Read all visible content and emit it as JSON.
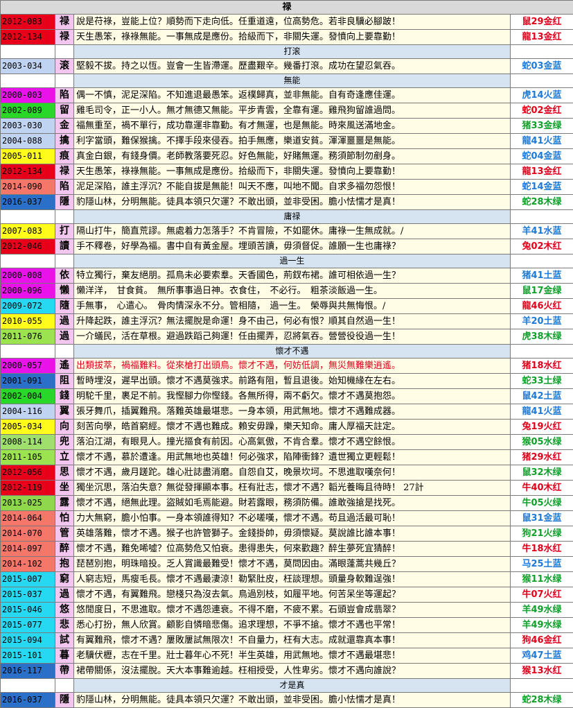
{
  "title": "禄",
  "groups": [
    {
      "name": "",
      "rows": [
        {
          "year": "2012-083",
          "yc": "y-red",
          "ch": "禄",
          "text": "說是苻祿，豈能上位？順勢而下走向低。任重道遠，位高勢危。若非良驥必腳跛！",
          "lot": "鼠29金红",
          "lc": "rd"
        },
        {
          "year": "2012-134",
          "yc": "y-red",
          "ch": "禄",
          "text": "天生愚笨，祿祿無能。一事無成是應份。拾級而下，非關失運。發憤向上要靠勤！",
          "lot": "龍13金红",
          "lc": "rd"
        }
      ]
    },
    {
      "name": "打滚",
      "rows": [
        {
          "year": "2003-034",
          "yc": "y-lightblue",
          "ch": "滚",
          "text": "堅毅不拔。持之以恆。豈會一生皆滯運。歷盡艱辛。幾番打滾。成功在望忍氣吞。",
          "lot": "蛇03金蓝",
          "lc": "bl"
        }
      ]
    },
    {
      "name": "無能",
      "rows": [
        {
          "year": "2000-003",
          "yc": "y-magenta",
          "ch": "陷",
          "text": "偶一不慎，泥足深陷。不知進退最愚笨。返樸歸真，並非無能。自有奇逢應佳運。",
          "lot": "虎14火蓝",
          "lc": "bl"
        },
        {
          "year": "2002-089",
          "yc": "y-green",
          "ch": "留",
          "text": "雞毛司令，正一小人。無才無德又無能。平步青雲，全靠有運。雞飛狗留誰過問。",
          "lot": "蛇02金红",
          "lc": "rd"
        },
        {
          "year": "2003-030",
          "yc": "y-lightblue",
          "ch": "金",
          "text": "福無重至，禍不單行，成功靠運非靠勤。有才無運，也是無能。時來風送滿地金。",
          "lot": "猪33金绿",
          "lc": "gr"
        },
        {
          "year": "2004-088",
          "yc": "y-lightblue",
          "ch": "擒",
          "text": "利字當頭，難保猴擒。不擇手段來侵吞。拍手無應，樂道安貧。渾渾噩噩是無能。",
          "lot": "龍41火蓝",
          "lc": "bl"
        },
        {
          "year": "2005-011",
          "yc": "y-yellow",
          "ch": "痕",
          "text": "真金白銀，有錢身價。老師教落要死忍。好色無能，好賭無運。務須節制勿剷身。",
          "lot": "蛇04金蓝",
          "lc": "bl"
        },
        {
          "year": "2012-134",
          "yc": "y-red",
          "ch": "禄",
          "text": "天生愚笨，祿祿無能。一事無成是應份。拾級而下，非關失運。發憤向上要靠勤！",
          "lot": "龍13金红",
          "lc": "rd"
        },
        {
          "year": "2014-090",
          "yc": "y-salmon",
          "ch": "陷",
          "text": "泥足深陷，誰主浮沉？不能自拔是無能！叫天不應，叫地不聞。自求多福勿怨恨！",
          "lot": "蛇14金蓝",
          "lc": "bl"
        },
        {
          "year": "2016-037",
          "yc": "y-blue",
          "ch": "隱",
          "text": "豹隱山林，分明無能。徒具本領只欠運？不敢出頭，並非受困。膽小怯懦才是真！",
          "lot": "蛇28木绿",
          "lc": "gr"
        }
      ]
    },
    {
      "name": "庸禄",
      "rows": [
        {
          "year": "2007-083",
          "yc": "y-yellow",
          "ch": "打",
          "text": "隔山打牛，簡直荒謬。無處着力怎落手？不肯冒險，不如罷休。庸祿一生無成就。/",
          "lot": "羊41水蓝",
          "lc": "bl"
        },
        {
          "year": "2012-046",
          "yc": "y-red",
          "ch": "讀",
          "text": "手不釋卷，好學為福。書中自有黃金屋。埋頭苦讀，毋須督促。誰願一生也庸祿？",
          "lot": "兔02木红",
          "lc": "rd"
        }
      ]
    },
    {
      "name": "過一生",
      "rows": [
        {
          "year": "2000-008",
          "yc": "y-magenta",
          "ch": "依",
          "text": "特立獨行，棄友絕朋。孤鳥未必要索羣。天香國色，荊釵布裙。誰可相依過一生？",
          "lot": "猪41土蓝",
          "lc": "bl"
        },
        {
          "year": "2000-096",
          "yc": "y-magenta",
          "ch": "懶",
          "text": "懶洋洋，　甘食貧。　無所事事過日神。衣食住，　不必行。　粗茶淡飯過一生。",
          "lot": "鼠17金绿",
          "lc": "gr"
        },
        {
          "year": "2009-072",
          "yc": "y-cyan",
          "ch": "隨",
          "text": "手無事，　心遣心。　骨肉情深永不分。管相隨，　過一生。　榮辱與共無悔恨。/",
          "lot": "龍46火红",
          "lc": "rd"
        },
        {
          "year": "2010-055",
          "yc": "y-yellow",
          "ch": "過",
          "text": "升降起跌，誰主浮沉？無法擺脫是命運！身不由己，何必有恨？順其自然過一生！",
          "lot": "羊20土蓝",
          "lc": "bl"
        },
        {
          "year": "2011-076",
          "yc": "y-lime",
          "ch": "過",
          "text": "一介蟻民，活在草根。避過跌蹈己夠運！任由擺弄，忍將氣吞。營營役役過一生！",
          "lot": "虎38木绿",
          "lc": "gr"
        }
      ]
    },
    {
      "name": "懷才不遇",
      "rows": [
        {
          "year": "2000-057",
          "yc": "y-magenta",
          "ch": "遙",
          "text": "出類拔萃，禍福難料。從來槍打出頭鳥。懷才不遇，何妨低調，無災無難樂逍遙。",
          "lot": "猪18水红",
          "lc": "rd",
          "hl": true
        },
        {
          "year": "2001-091",
          "yc": "y-blue",
          "ch": "阻",
          "text": "暫時埋沒，遲早出頭。懷才不遇莫強求。前路有阻，暫且退後。始知機緣在左右。",
          "lot": "蛇33土绿",
          "lc": "gr"
        },
        {
          "year": "2002-004",
          "yc": "y-green",
          "ch": "錢",
          "text": "明駝千里，裹足不前。我慳腳力你慳錢。各無所得，兩不虧欠。懷才不遇莫抱怨。",
          "lot": "鼠42土蓝",
          "lc": "bl"
        },
        {
          "year": "2004-116",
          "yc": "y-lightblue",
          "ch": "翼",
          "text": "張牙舞爪，插翼難飛。落難英雄最堪悲。一身本領，用武無地。懷才不遇難成器。",
          "lot": "龍41火蓝",
          "lc": "bl"
        },
        {
          "year": "2005-034",
          "yc": "y-yellow",
          "ch": "向",
          "text": "刻苦向學，皓首窮經。懷才不遇也難成。賴安毋躁，樂天知命。庸人厚福天註定。",
          "lot": "兔19火红",
          "lc": "rd"
        },
        {
          "year": "2008-114",
          "yc": "y-mint",
          "ch": "兜",
          "text": "落泊江湖，有眼見人。撞光摳食有前因。心高氣傲，不肯合羣。懷才不遇空餘恨。",
          "lot": "猴05水绿",
          "lc": "gr"
        },
        {
          "year": "2011-105",
          "yc": "y-lime",
          "ch": "立",
          "text": "懷才不遇，慕於遭逢。用武無地也英雄！何必強求，陷陣衝鋒？遺世獨立更輕鬆！",
          "lot": "猪29水红",
          "lc": "rd"
        },
        {
          "year": "2012-056",
          "yc": "y-red",
          "ch": "思",
          "text": "懷才不遇，歲月蹉跎。雄心壯誌盡消磨。自怨自艾，晚景坎坷。不思進取嘆奈何！",
          "lot": "鼠32木绿",
          "lc": "gr"
        },
        {
          "year": "2012-119",
          "yc": "y-red",
          "ch": "坐",
          "text": "獨坐沉思，落泊失意？無從發揮顯本事。枉有壯志，懷才不遇？韜光養晦且待時！ 27計",
          "lot": "牛40木红",
          "lc": "rd"
        },
        {
          "year": "2013-025",
          "yc": "y-olive",
          "ch": "露",
          "text": "懷才不遇，絕無此理。盜賊如毛焉能避。財若露眼，務須防備。誰敢強搶是找死。",
          "lot": "牛05火绿",
          "lc": "gr"
        },
        {
          "year": "2014-064",
          "yc": "y-salmon",
          "ch": "怕",
          "text": "力大無窮，膽小怕事。一身本領誰得知？不必嗟嘆，懷才不遇。苟且過活最可恥！",
          "lot": "鼠31金蓝",
          "lc": "bl"
        },
        {
          "year": "2014-070",
          "yc": "y-salmon",
          "ch": "管",
          "text": "英雄落難，懷才不遇。猴子也許管獅子。金錢掛帥，毋須懷疑。莫說誰比誰本事！",
          "lot": "狗21火绿",
          "lc": "gr"
        },
        {
          "year": "2014-097",
          "yc": "y-salmon",
          "ch": "醉",
          "text": "懷才不遇，難免唏噓？位高勢危又怕衰。患得患失，何來歡趣？醉生夢死宜猜醉！",
          "lot": "牛18水红",
          "lc": "rd"
        },
        {
          "year": "2014-102",
          "yc": "y-salmon",
          "ch": "抱",
          "text": "琵琶別抱，明珠暗投。乏人賞識最難受！懷才不遇，莫問因由。滿眼蓬蒿共幾丘？",
          "lot": "马25土蓝",
          "lc": "bl"
        },
        {
          "year": "2015-007",
          "yc": "y-cyan",
          "ch": "窮",
          "text": "人窮志短，馬瘦毛長。懷才不遇最淒涼！勒緊肚皮，枉談理想。頭量身軟難逞強！",
          "lot": "猴11水绿",
          "lc": "gr"
        },
        {
          "year": "2015-037",
          "yc": "y-cyan",
          "ch": "過",
          "text": "懷才不遇，有翼難飛。戀棧只為沒去氣。鳥過別枝，如履平地。何苦呆坐等運起？",
          "lot": "牛07火红",
          "lc": "rd"
        },
        {
          "year": "2015-046",
          "yc": "y-cyan",
          "ch": "悠",
          "text": "悠閒度日，不思進取。懷才不遇怨連衰。不得不磨，不疲不累。石頭豈會成翡翠？",
          "lot": "羊49水绿",
          "lc": "gr"
        },
        {
          "year": "2015-077",
          "yc": "y-cyan",
          "ch": "悲",
          "text": "悉心打扮，無人欣賞。顧影自憐暗悲傷。追求理想，不爭不搶。懷才不遇也平常！",
          "lot": "羊49水绿",
          "lc": "gr"
        },
        {
          "year": "2015-094",
          "yc": "y-cyan",
          "ch": "試",
          "text": "有翼難飛，懷才不遇？屢敗屢試無限次！不自量力，枉有大志。成就還靠真本事！",
          "lot": "狗46金红",
          "lc": "rd"
        },
        {
          "year": "2015-101",
          "yc": "y-cyan",
          "ch": "暮",
          "text": "老驥伏櫪，志在千里。壯士暮年心不死！半生英雄，用武無地。懷才不遇最堪悲！",
          "lot": "鸡47土蓝",
          "lc": "bl"
        },
        {
          "year": "2016-117",
          "yc": "y-blue",
          "ch": "帶",
          "text": "裙帶關係，沒法擺脫。天大本事難逾越。枉相授受，人性卑劣。懷才不遇向誰說？",
          "lot": "猴13水红",
          "lc": "rd"
        }
      ]
    },
    {
      "name": "才是真",
      "rows": [
        {
          "year": "2016-037",
          "yc": "y-blue",
          "ch": "隱",
          "text": "豹隱山林，分明無能。徒具本領只欠運？不敢出頭，並非受困。膽小怯懦才是真！",
          "lot": "蛇28木绿",
          "lc": "gr"
        }
      ]
    }
  ]
}
